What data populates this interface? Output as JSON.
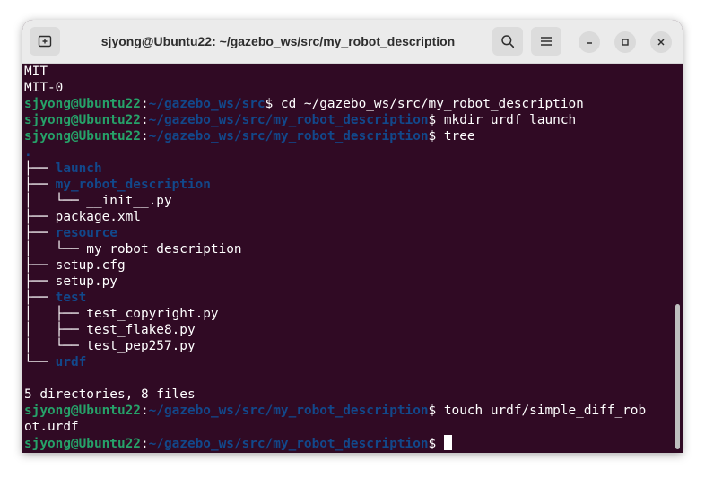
{
  "window": {
    "title": "sjyong@Ubuntu22: ~/gazebo_ws/src/my_robot_description"
  },
  "icons": {
    "new_tab": "new-tab-icon",
    "search": "search-icon",
    "menu": "hamburger-menu-icon",
    "minimize": "minimize-icon",
    "maximize": "maximize-icon",
    "close": "close-icon"
  },
  "colors": {
    "terminal_bg": "#300a24",
    "prompt_user": "#26a269",
    "prompt_path": "#12488b",
    "text": "#ffffff"
  },
  "terminal": {
    "lines": [
      {
        "segments": [
          {
            "text": "MIT",
            "cls": "plain"
          }
        ]
      },
      {
        "segments": [
          {
            "text": "MIT-0",
            "cls": "plain"
          }
        ]
      },
      {
        "segments": [
          {
            "text": "sjyong@Ubuntu22",
            "cls": "user"
          },
          {
            "text": ":",
            "cls": "plain"
          },
          {
            "text": "~/gazebo_ws/src",
            "cls": "path"
          },
          {
            "text": "$ cd ~/gazebo_ws/src/my_robot_description",
            "cls": "plain"
          }
        ]
      },
      {
        "segments": [
          {
            "text": "sjyong@Ubuntu22",
            "cls": "user"
          },
          {
            "text": ":",
            "cls": "plain"
          },
          {
            "text": "~/gazebo_ws/src/my_robot_description",
            "cls": "path"
          },
          {
            "text": "$ mkdir urdf launch",
            "cls": "plain"
          }
        ]
      },
      {
        "segments": [
          {
            "text": "sjyong@Ubuntu22",
            "cls": "user"
          },
          {
            "text": ":",
            "cls": "plain"
          },
          {
            "text": "~/gazebo_ws/src/my_robot_description",
            "cls": "path"
          },
          {
            "text": "$ tree",
            "cls": "plain"
          }
        ]
      },
      {
        "segments": [
          {
            "text": ".",
            "cls": "dir"
          }
        ]
      },
      {
        "segments": [
          {
            "text": "├── ",
            "cls": "plain"
          },
          {
            "text": "launch",
            "cls": "dir"
          }
        ]
      },
      {
        "segments": [
          {
            "text": "├── ",
            "cls": "plain"
          },
          {
            "text": "my_robot_description",
            "cls": "dir"
          }
        ]
      },
      {
        "segments": [
          {
            "text": "│   └── __init__.py",
            "cls": "plain"
          }
        ]
      },
      {
        "segments": [
          {
            "text": "├── package.xml",
            "cls": "plain"
          }
        ]
      },
      {
        "segments": [
          {
            "text": "├── ",
            "cls": "plain"
          },
          {
            "text": "resource",
            "cls": "dir"
          }
        ]
      },
      {
        "segments": [
          {
            "text": "│   └── my_robot_description",
            "cls": "plain"
          }
        ]
      },
      {
        "segments": [
          {
            "text": "├── setup.cfg",
            "cls": "plain"
          }
        ]
      },
      {
        "segments": [
          {
            "text": "├── setup.py",
            "cls": "plain"
          }
        ]
      },
      {
        "segments": [
          {
            "text": "├── ",
            "cls": "plain"
          },
          {
            "text": "test",
            "cls": "dir"
          }
        ]
      },
      {
        "segments": [
          {
            "text": "│   ├── test_copyright.py",
            "cls": "plain"
          }
        ]
      },
      {
        "segments": [
          {
            "text": "│   ├── test_flake8.py",
            "cls": "plain"
          }
        ]
      },
      {
        "segments": [
          {
            "text": "│   └── test_pep257.py",
            "cls": "plain"
          }
        ]
      },
      {
        "segments": [
          {
            "text": "└── ",
            "cls": "plain"
          },
          {
            "text": "urdf",
            "cls": "dir"
          }
        ]
      },
      {
        "segments": [
          {
            "text": "",
            "cls": "plain"
          }
        ]
      },
      {
        "segments": [
          {
            "text": "5 directories, 8 files",
            "cls": "plain"
          }
        ]
      },
      {
        "segments": [
          {
            "text": "sjyong@Ubuntu22",
            "cls": "user"
          },
          {
            "text": ":",
            "cls": "plain"
          },
          {
            "text": "~/gazebo_ws/src/my_robot_description",
            "cls": "path"
          },
          {
            "text": "$ touch urdf/simple_diff_rob",
            "cls": "plain"
          }
        ]
      },
      {
        "segments": [
          {
            "text": "ot.urdf",
            "cls": "plain"
          }
        ]
      },
      {
        "segments": [
          {
            "text": "sjyong@Ubuntu22",
            "cls": "user"
          },
          {
            "text": ":",
            "cls": "plain"
          },
          {
            "text": "~/gazebo_ws/src/my_robot_description",
            "cls": "path"
          },
          {
            "text": "$ ",
            "cls": "plain"
          }
        ],
        "cursor": true
      }
    ]
  }
}
